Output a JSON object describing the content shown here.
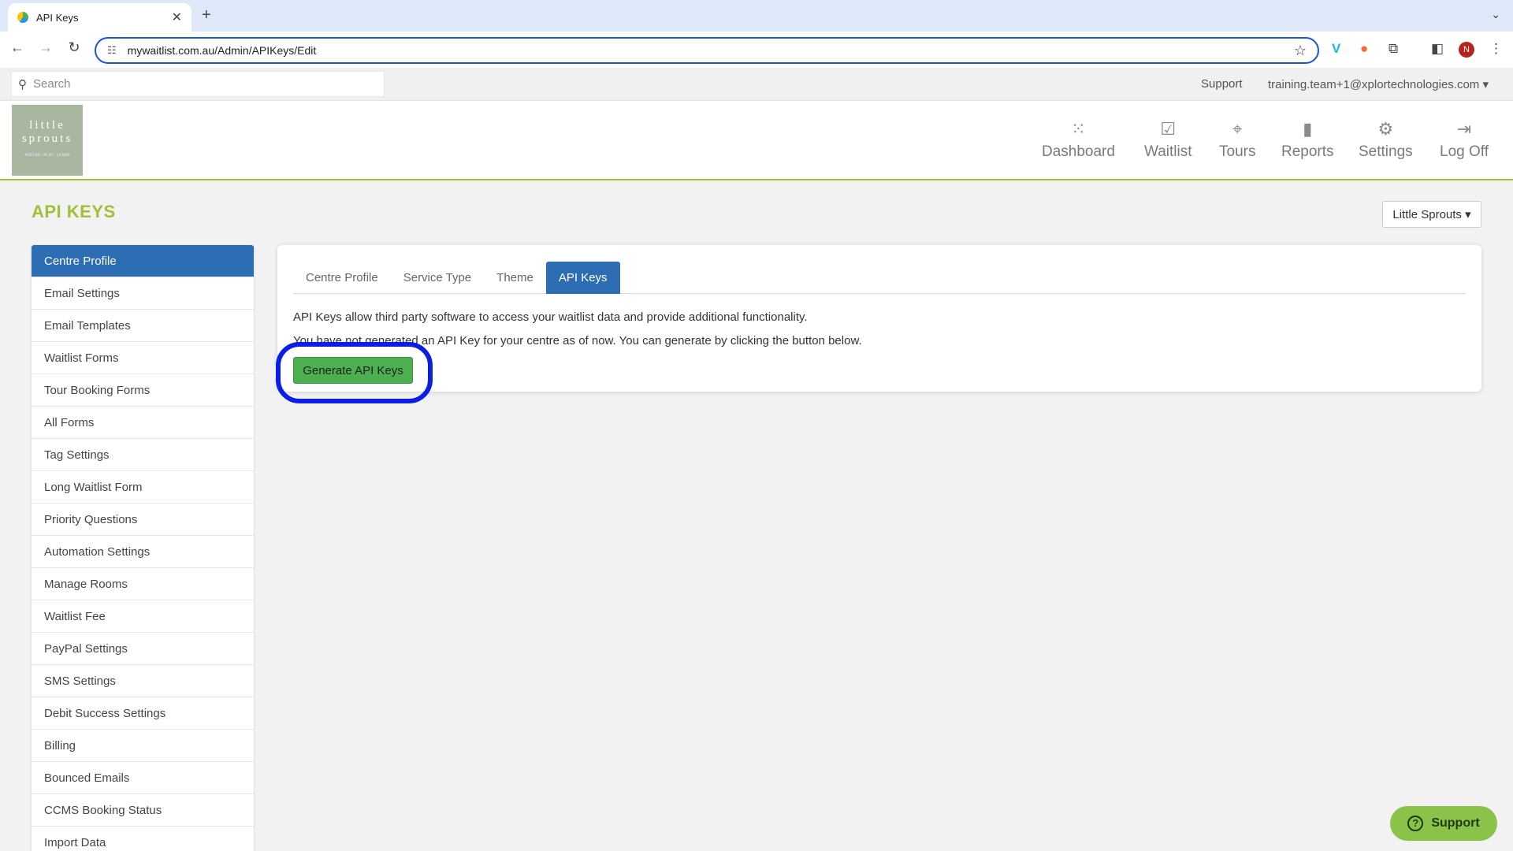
{
  "browser": {
    "tab_title": "API Keys",
    "url": "mywaitlist.com.au/Admin/APIKeys/Edit",
    "profile_initial": "N"
  },
  "topbar": {
    "search_placeholder": "Search",
    "support": "Support",
    "user": "training.team+1@xplortechnologies.com"
  },
  "logo": {
    "line1": "little",
    "line2": "sprouts",
    "tagline": "NATURE · PLAY · LEARN"
  },
  "nav": [
    {
      "label": "Dashboard",
      "icon": "grid-icon"
    },
    {
      "label": "Waitlist",
      "icon": "inbox-check-icon"
    },
    {
      "label": "Tours",
      "icon": "map-icon"
    },
    {
      "label": "Reports",
      "icon": "bar-chart-icon"
    },
    {
      "label": "Settings",
      "icon": "gear-icon"
    },
    {
      "label": "Log Off",
      "icon": "sign-out-icon"
    }
  ],
  "page": {
    "title": "API KEYS",
    "centre_select": "Little Sprouts"
  },
  "sidebar": [
    "Centre Profile",
    "Email Settings",
    "Email Templates",
    "Waitlist Forms",
    "Tour Booking Forms",
    "All Forms",
    "Tag Settings",
    "Long Waitlist Form",
    "Priority Questions",
    "Automation Settings",
    "Manage Rooms",
    "Waitlist Fee",
    "PayPal Settings",
    "SMS Settings",
    "Debit Success Settings",
    "Billing",
    "Bounced Emails",
    "CCMS Booking Status",
    "Import Data"
  ],
  "panel": {
    "tabs": [
      "Centre Profile",
      "Service Type",
      "Theme",
      "API Keys"
    ],
    "active_tab": "API Keys",
    "desc1": "API Keys allow third party software to access your waitlist data and provide additional functionality.",
    "desc2": "You have not generated an API Key for your centre as of now. You can generate by clicking the button below.",
    "button": "Generate API Keys"
  },
  "support_fab": "Support",
  "colors": {
    "accent_green": "#a2c037",
    "active_blue": "#2d6db3",
    "button_green": "#4caf50",
    "highlight": "#0a1ee6"
  }
}
